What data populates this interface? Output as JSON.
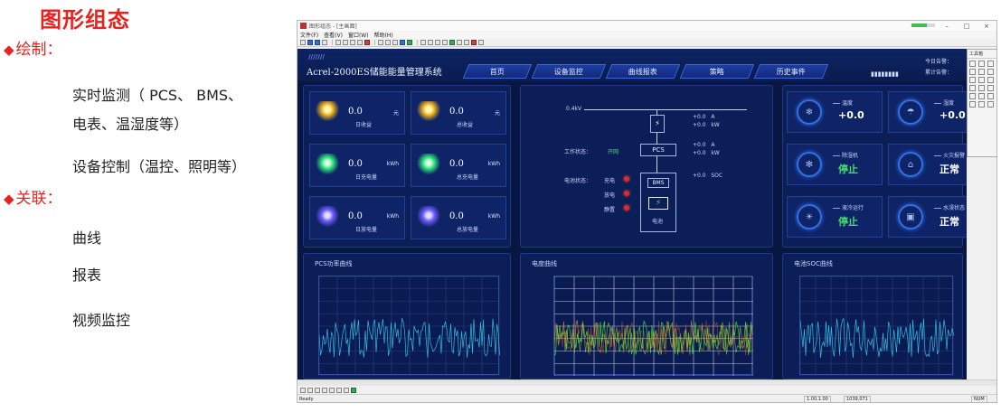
{
  "slide": {
    "title": "图形组态",
    "draw_heading": "绘制：",
    "draw_items": [
      "实时监测（ PCS、 BMS、",
      "电表、温湿度等）",
      "设备控制（温控、照明等）"
    ],
    "relate_heading": "关联：",
    "relate_items": [
      "曲线",
      "报表",
      "视频监控"
    ],
    "accent_color": "#e8231f"
  },
  "window": {
    "title": "图形组态 - [主画面]",
    "menu": [
      "文件(F)",
      "查看(V)",
      "窗口(W)",
      "帮助(H)"
    ],
    "progress_fraction": 0.65
  },
  "hmi": {
    "system_title": "Acrel-2000ES储能能量管理系统",
    "nav": [
      "首页",
      "设备监控",
      "曲线报表",
      "策略",
      "历史事件"
    ],
    "alarms": [
      "今日告警：",
      "累计告警："
    ],
    "revenue": [
      {
        "value": "0.0",
        "unit": "元",
        "label": "日收益",
        "icon": "gold-coin-icon"
      },
      {
        "value": "0.0",
        "unit": "元",
        "label": "总收益",
        "icon": "gold-coin-icon"
      },
      {
        "value": "0.0",
        "unit": "kWh",
        "label": "日充电量",
        "icon": "green-charge-icon"
      },
      {
        "value": "0.0",
        "unit": "kWh",
        "label": "总充电量",
        "icon": "green-charge-icon"
      },
      {
        "value": "0.0",
        "unit": "kWh",
        "label": "日放电量",
        "icon": "blue-discharge-icon"
      },
      {
        "value": "0.0",
        "unit": "kWh",
        "label": "总放电量",
        "icon": "blue-discharge-icon"
      }
    ],
    "diagram": {
      "voltage": "0.4kV",
      "meter_values": [
        "+0.0",
        "+0.0"
      ],
      "meter_units": [
        "A",
        "kW"
      ],
      "work_status_label": "工作状态：",
      "work_status_value": "开网",
      "pcs_label": "PCS",
      "pcs_values": [
        "+0.0",
        "+0.0"
      ],
      "pcs_units": [
        "A",
        "kW"
      ],
      "battery_status_label": "电池状态：",
      "battery_states": [
        "充电",
        "放电",
        "静置"
      ],
      "bms_label": "BMS",
      "soc_value": "+0.0",
      "soc_unit": "SOC",
      "battery_label": "电池"
    },
    "env": [
      {
        "label": "温度",
        "value": "+0.0",
        "color": "#ffffff",
        "icon": "aircon-icon"
      },
      {
        "label": "湿度",
        "value": "+0.0 ℃",
        "color": "#ffffff",
        "icon": "humidity-icon"
      },
      {
        "label": "除湿机",
        "value": "停止",
        "color": "#3fe06a",
        "icon": "fan-icon"
      },
      {
        "label": "火灾报警",
        "value": "正常",
        "color": "#ffffff",
        "icon": "fire-alarm-icon"
      },
      {
        "label": "液冷运行",
        "value": "停止",
        "color": "#3fe06a",
        "icon": "bulb-icon"
      },
      {
        "label": "水浸状态",
        "value": "正常",
        "color": "#ffffff",
        "icon": "water-sensor-icon"
      }
    ],
    "charts": [
      "PCS功率曲线",
      "电度曲线",
      "电池SOC曲线"
    ]
  },
  "palette": {
    "title": "工具箱"
  },
  "statusbar": {
    "ready": "Ready",
    "coord": "1.00,1.00",
    "pos": "1039,071",
    "num": "NUM"
  }
}
